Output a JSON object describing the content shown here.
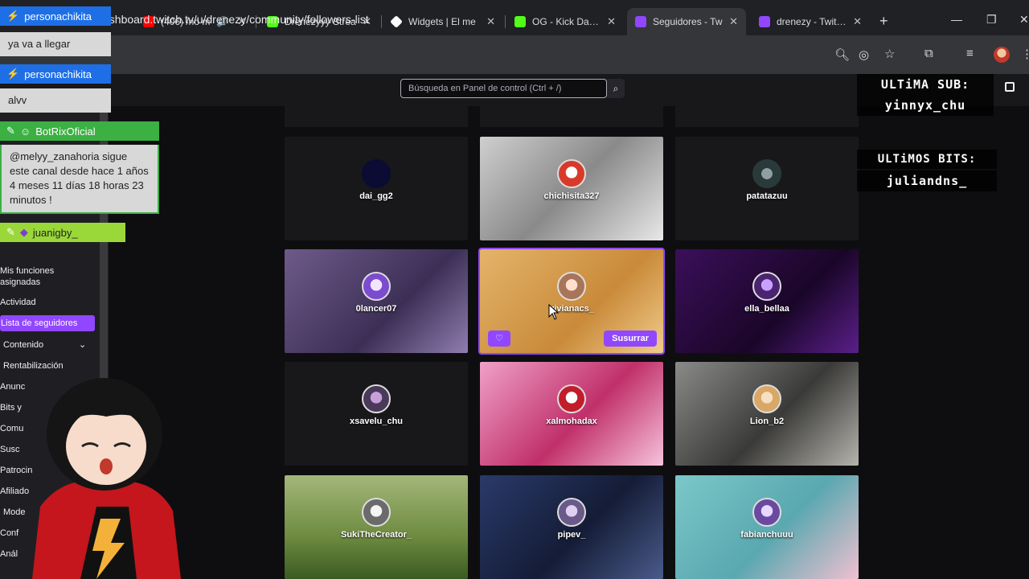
{
  "browser": {
    "tabs": [
      {
        "label": "(406) /no m",
        "favicon": "youtube",
        "color": "#ff0000"
      },
      {
        "label": "Drenezyyy Strea",
        "favicon": "kick",
        "color": "#53fc18"
      },
      {
        "label": "Widgets | El me",
        "favicon": "widget",
        "color": "#ffffff"
      },
      {
        "label": "OG - Kick Dashb",
        "favicon": "kick",
        "color": "#53fc18"
      },
      {
        "label": "Seguidores - Tw",
        "favicon": "twitch",
        "color": "#9147ff"
      },
      {
        "label": "drenezy - Twitch",
        "favicon": "twitch",
        "color": "#9147ff"
      }
    ],
    "url": "ashboard.twitch.tv/u/drenezy/community/followers-list"
  },
  "dashboard": {
    "search_placeholder": "Búsqueda en Panel de control (Ctrl + /)",
    "sidebar": [
      {
        "label": "Mis funciones asignadas"
      },
      {
        "label": "Actividad"
      },
      {
        "label": "Lista de seguidores",
        "active": true
      },
      {
        "label": "Contenido"
      },
      {
        "label": "Rentabilización"
      },
      {
        "label": "Anunc"
      },
      {
        "label": "Bits y"
      },
      {
        "label": "Comu"
      },
      {
        "label": "Susc"
      },
      {
        "label": "Patrocin"
      },
      {
        "label": "Afiliado"
      },
      {
        "label": "Mode"
      },
      {
        "label": "Conf"
      },
      {
        "label": "Anál"
      }
    ],
    "followers": [
      {
        "name": "dai_gg2"
      },
      {
        "name": "chichisita327"
      },
      {
        "name": "patatazuu"
      },
      {
        "name": "0lancer07"
      },
      {
        "name": "vivianacs_"
      },
      {
        "name": "ella_bellaa"
      },
      {
        "name": "xsavelu_chu"
      },
      {
        "name": "xalmohadax"
      },
      {
        "name": "Lion_b2"
      },
      {
        "name": "SukiTheCreator_"
      },
      {
        "name": "pipev_"
      },
      {
        "name": "fabianchuuu"
      }
    ],
    "whisper_label": "Susurrar"
  },
  "overlay": {
    "chat": [
      {
        "user": "personachikita",
        "message": "ya va a llegar",
        "color": "#1e6fe6"
      },
      {
        "user": "personachikita",
        "message": "alvv",
        "color": "#1e6fe6"
      },
      {
        "user": "BotRixOficial",
        "message": "@melyy_zanahoria sigue este canal desde hace 1 años 4 meses 11 días 18 horas 23 minutos !",
        "color": "#3cb043"
      },
      {
        "user": "juanigby_",
        "message": "",
        "color": "#9ad83a"
      }
    ],
    "last_sub_label": "ULTiMA SUB:",
    "last_sub_user": "yinnyx_chu",
    "last_bits_label": "ULTiMOS BITS:",
    "last_bits_user": "juliandns_"
  }
}
